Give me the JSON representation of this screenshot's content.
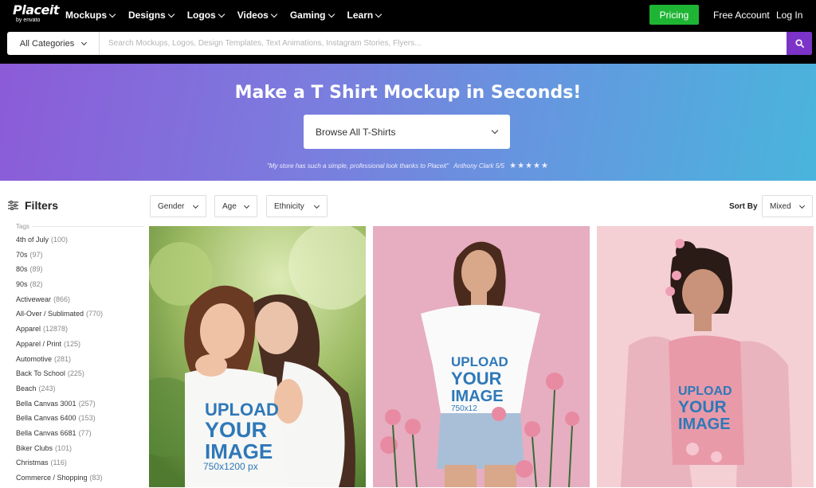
{
  "logo": {
    "main": "Placeit",
    "sub": "by envato"
  },
  "nav": [
    {
      "label": "Mockups"
    },
    {
      "label": "Designs"
    },
    {
      "label": "Logos"
    },
    {
      "label": "Videos"
    },
    {
      "label": "Gaming"
    },
    {
      "label": "Learn"
    }
  ],
  "header": {
    "pricing": "Pricing",
    "free_account": "Free Account",
    "login": "Log In"
  },
  "search": {
    "category": "All Categories",
    "placeholder": "Search Mockups, Logos, Design Templates, Text Animations, Instagram Stories, Flyers..."
  },
  "hero": {
    "title": "Make a T Shirt Mockup in Seconds!",
    "browse": "Browse All T-Shirts",
    "quote": "\"My store has such a simple, professional look thanks to Placeit\"",
    "author": "Anthony Clark 5/5",
    "stars": "★★★★★"
  },
  "filters": {
    "title": "Filters",
    "tags_label": "Tags",
    "tags": [
      {
        "name": "4th of July",
        "count": "(100)"
      },
      {
        "name": "70s",
        "count": "(97)"
      },
      {
        "name": "80s",
        "count": "(89)"
      },
      {
        "name": "90s",
        "count": "(82)"
      },
      {
        "name": "Activewear",
        "count": "(866)"
      },
      {
        "name": "All-Over / Sublimated",
        "count": "(770)"
      },
      {
        "name": "Apparel",
        "count": "(12878)"
      },
      {
        "name": "Apparel / Print",
        "count": "(125)"
      },
      {
        "name": "Automotive",
        "count": "(281)"
      },
      {
        "name": "Back To School",
        "count": "(225)"
      },
      {
        "name": "Beach",
        "count": "(243)"
      },
      {
        "name": "Bella Canvas 3001",
        "count": "(257)"
      },
      {
        "name": "Bella Canvas 6400",
        "count": "(153)"
      },
      {
        "name": "Bella Canvas 6681",
        "count": "(77)"
      },
      {
        "name": "Biker Clubs",
        "count": "(101)"
      },
      {
        "name": "Christmas",
        "count": "(116)"
      },
      {
        "name": "Commerce / Shopping",
        "count": "(83)"
      }
    ]
  },
  "toolbar": {
    "gender": "Gender",
    "age": "Age",
    "ethnicity": "Ethnicity",
    "sort_label": "Sort By",
    "sort_value": "Mixed"
  },
  "cards": [
    {
      "line1": "UPLOAD",
      "line2": "YOUR",
      "line3": "IMAGE",
      "line4": "750x1200 px"
    },
    {
      "line1": "UPLOAD",
      "line2": "YOUR",
      "line3": "IMAGE",
      "line4": "750x12"
    },
    {
      "line1": "UPLOAD",
      "line2": "YOUR",
      "line3": "IMAGE"
    }
  ]
}
